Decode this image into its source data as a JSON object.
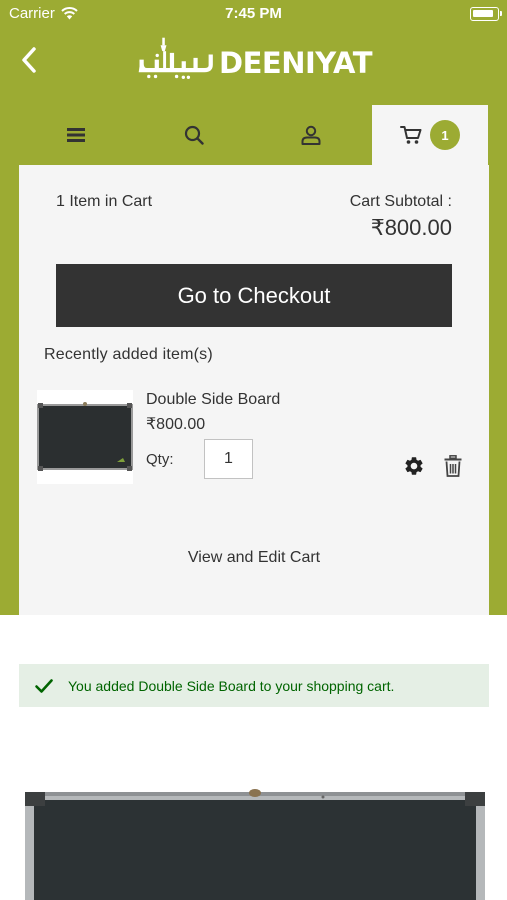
{
  "status_bar": {
    "carrier": "Carrier",
    "time": "7:45 PM"
  },
  "header": {
    "logo_text": "DEENIYAT",
    "back_icon": "chevron-left-icon"
  },
  "nav": {
    "tabs": [
      {
        "name": "menu",
        "icon": "hamburger-icon"
      },
      {
        "name": "search",
        "icon": "search-icon"
      },
      {
        "name": "account",
        "icon": "user-icon"
      },
      {
        "name": "cart",
        "icon": "cart-icon",
        "badge": "1",
        "active": true
      }
    ]
  },
  "minicart": {
    "items_count_number": "1",
    "items_count_text": "Item in Cart",
    "subtotal_label": "Cart Subtotal :",
    "subtotal_value": "₹800.00",
    "checkout_label": "Go to Checkout",
    "recent_label": "Recently added item(s)",
    "item": {
      "name": "Double Side Board",
      "price": "₹800.00",
      "qty_label": "Qty:",
      "qty_value": "1"
    },
    "view_edit_label": "View and Edit Cart"
  },
  "message": {
    "text": "You added Double Side Board to your shopping cart."
  },
  "colors": {
    "brand_green": "#9cab33",
    "button_dark": "#333333",
    "panel_bg": "#f5f5f5",
    "success_bg": "#e5efe5",
    "success_text": "#006400"
  }
}
